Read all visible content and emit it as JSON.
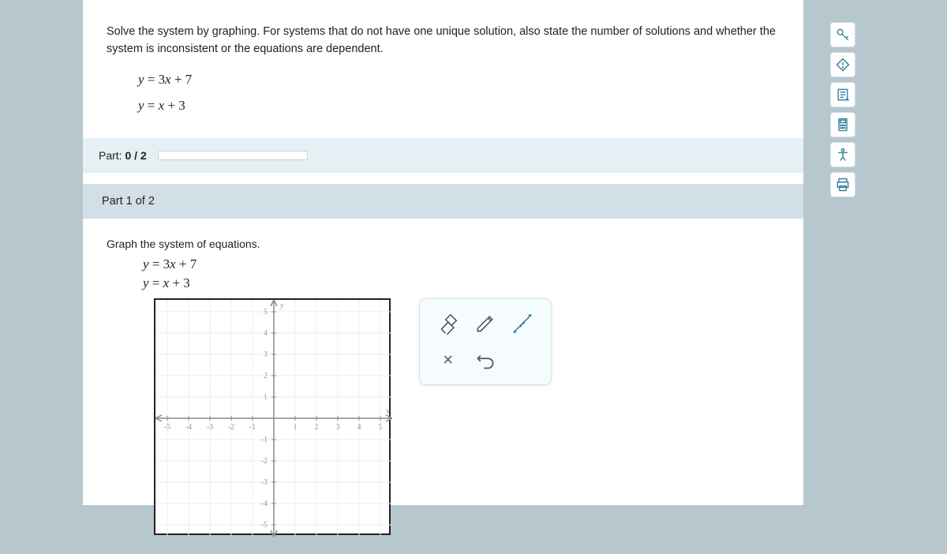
{
  "problem": {
    "statement": "Solve the system by graphing. For systems that do not have one unique solution, also state the number of solutions and whether the system is inconsistent or the equations are dependent.",
    "equation1": "y = 3x + 7",
    "equation2": "y = x + 3"
  },
  "progress": {
    "label_prefix": "Part:",
    "current": "0",
    "sep": "/",
    "total": "2",
    "percent": 0
  },
  "part": {
    "title": "Part 1 of 2",
    "instruction": "Graph the system of equations.",
    "equation1": "y = 3x + 7",
    "equation2": "y = x + 3"
  },
  "graph": {
    "x_label": "x",
    "y_label": "y",
    "xmin": -5,
    "xmax": 5,
    "ymin": -5,
    "ymax": 5,
    "ticks_x": [
      "-5",
      "-4",
      "-3",
      "-2",
      "-1",
      "",
      "1",
      "2",
      "3",
      "4",
      "5"
    ],
    "ticks_y": [
      "5",
      "4",
      "3",
      "2",
      "1",
      "",
      "-1",
      "-2",
      "-3",
      "-4",
      "-5"
    ]
  },
  "tools": {
    "eraser": "eraser",
    "pencil": "pencil",
    "line": "line",
    "clear": "×",
    "undo": "↶"
  },
  "sidebar": [
    "key",
    "hint",
    "notes",
    "calculator",
    "accessibility",
    "print"
  ],
  "chart_data": {
    "type": "line",
    "title": "",
    "xlabel": "x",
    "ylabel": "y",
    "xlim": [
      -5,
      5
    ],
    "ylim": [
      -5,
      5
    ],
    "series": [
      {
        "name": "y = 3x + 7",
        "equation": "y = 3x + 7",
        "points": []
      },
      {
        "name": "y = x + 3",
        "equation": "y = x + 3",
        "points": []
      }
    ],
    "note": "Blank coordinate grid; no data plotted yet."
  }
}
